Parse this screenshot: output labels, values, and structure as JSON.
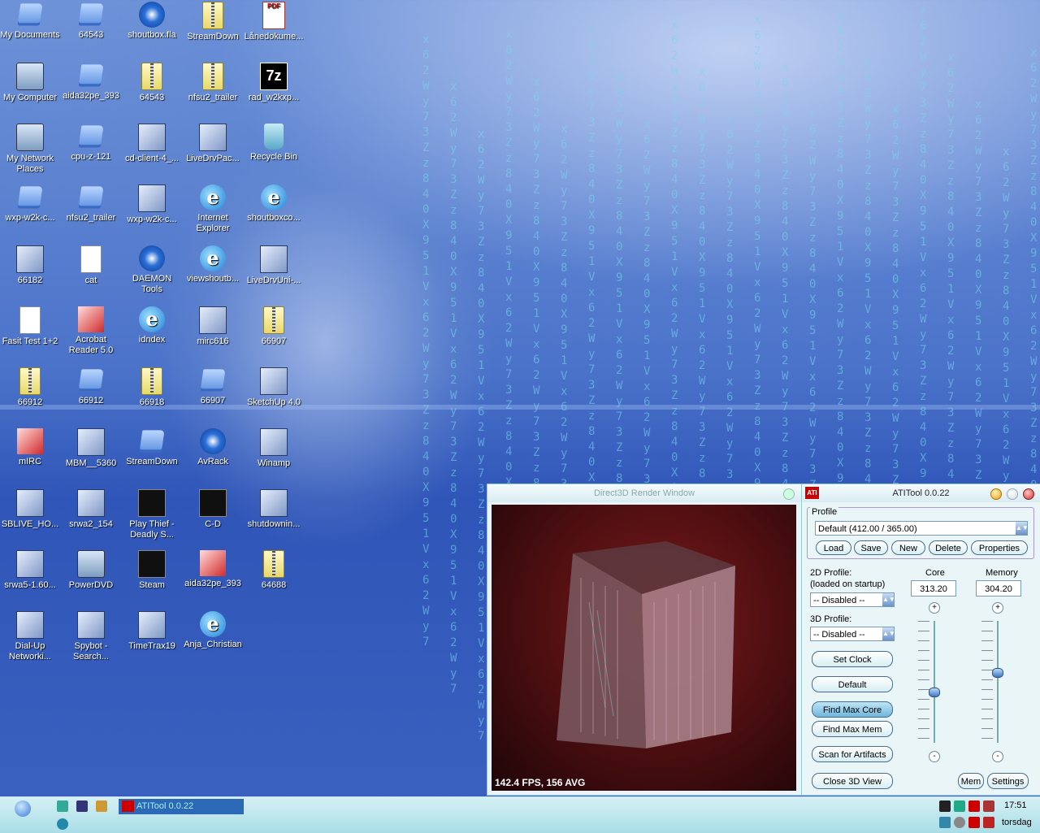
{
  "desktop": {
    "icons": [
      {
        "label": "My Documents",
        "icon": "my-documents-icon"
      },
      {
        "label": "64543",
        "icon": "folder-icon"
      },
      {
        "label": "shoutbox.fla",
        "icon": "flash-file-icon"
      },
      {
        "label": "StreamDown",
        "icon": "zip-folder-icon"
      },
      {
        "label": "Lånedokume...",
        "icon": "pdf-icon"
      },
      {
        "label": "My Computer",
        "icon": "my-computer-icon"
      },
      {
        "label": "aida32pe_393",
        "icon": "folder-icon"
      },
      {
        "label": "64543",
        "icon": "zip-folder-icon"
      },
      {
        "label": "nfsu2_trailer",
        "icon": "zip-folder-icon"
      },
      {
        "label": "rad_w2kxp...",
        "icon": "7z-archive-icon"
      },
      {
        "label": "My Network Places",
        "icon": "network-places-icon"
      },
      {
        "label": "cpu-z-121",
        "icon": "folder-icon"
      },
      {
        "label": "cd-client-4_...",
        "icon": "installer-icon"
      },
      {
        "label": "LiveDrvPac...",
        "icon": "installer-icon"
      },
      {
        "label": "Recycle Bin",
        "icon": "recycle-bin-icon"
      },
      {
        "label": "wxp-w2k-c...",
        "icon": "folder-icon"
      },
      {
        "label": "nfsu2_trailer",
        "icon": "folder-icon"
      },
      {
        "label": "wxp-w2k-c...",
        "icon": "installer-icon"
      },
      {
        "label": "Internet Explorer",
        "icon": "internet-explorer-icon"
      },
      {
        "label": "shoutboxco...",
        "icon": "ie-document-icon"
      },
      {
        "label": "66182",
        "icon": "installer-icon"
      },
      {
        "label": "cat",
        "icon": "text-document-icon"
      },
      {
        "label": "DAEMON Tools",
        "icon": "daemon-tools-icon"
      },
      {
        "label": "viewshoutb...",
        "icon": "ie-document-icon"
      },
      {
        "label": "LiveDrvUni-...",
        "icon": "installer-icon"
      },
      {
        "label": "Fasit Test 1+2",
        "icon": "text-document-icon"
      },
      {
        "label": "Acrobat Reader 5.0",
        "icon": "acrobat-icon"
      },
      {
        "label": "idndex",
        "icon": "ie-document-icon"
      },
      {
        "label": "mirc616",
        "icon": "installer-icon"
      },
      {
        "label": "66907",
        "icon": "zip-folder-icon"
      },
      {
        "label": "66912",
        "icon": "zip-folder-icon"
      },
      {
        "label": "66912",
        "icon": "folder-icon"
      },
      {
        "label": "66918",
        "icon": "zip-folder-icon"
      },
      {
        "label": "66907",
        "icon": "folder-icon"
      },
      {
        "label": "SketchUp 4.0",
        "icon": "sketchup-icon"
      },
      {
        "label": "mIRC",
        "icon": "mirc-icon"
      },
      {
        "label": "MBM__5360",
        "icon": "installer-icon"
      },
      {
        "label": "StreamDown",
        "icon": "folder-icon"
      },
      {
        "label": "AvRack",
        "icon": "avrack-icon"
      },
      {
        "label": "Winamp",
        "icon": "winamp-icon"
      },
      {
        "label": "SBLIVE_HO...",
        "icon": "installer-icon"
      },
      {
        "label": "srwa2_154",
        "icon": "installer-icon"
      },
      {
        "label": "Play Thief - Deadly S...",
        "icon": "game-icon"
      },
      {
        "label": "C-D",
        "icon": "cd-app-icon"
      },
      {
        "label": "shutdownin...",
        "icon": "installer-icon"
      },
      {
        "label": "srwa5-1.60...",
        "icon": "installer-icon"
      },
      {
        "label": "PowerDVD",
        "icon": "powerdvd-icon"
      },
      {
        "label": "Steam",
        "icon": "steam-icon"
      },
      {
        "label": "aida32pe_393",
        "icon": "winrar-icon"
      },
      {
        "label": "64688",
        "icon": "zip-folder-icon"
      },
      {
        "label": "Dial-Up Networki...",
        "icon": "dialup-icon"
      },
      {
        "label": "Spybot - Search...",
        "icon": "spybot-icon"
      },
      {
        "label": "TimeTrax19",
        "icon": "installer-icon"
      },
      {
        "label": "Anja_Christian",
        "icon": "ie-document-icon"
      }
    ]
  },
  "d3d_window": {
    "title": "Direct3D Render Window",
    "fps_text": "142.4 FPS, 156 AVG"
  },
  "atitool": {
    "title": "ATITool 0.0.22",
    "profile_label": "Profile",
    "profile_value": "Default (412.00 / 365.00)",
    "buttons": {
      "load": "Load",
      "save": "Save",
      "new": "New",
      "delete": "Delete",
      "properties": "Properties"
    },
    "profile2d_label": "2D Profile:",
    "profile2d_sub": "(loaded on startup)",
    "profile2d_value": "-- Disabled --",
    "profile3d_label": "3D Profile:",
    "profile3d_value": "-- Disabled --",
    "core_label": "Core",
    "core_value": "313.20",
    "memory_label": "Memory",
    "memory_value": "304.20",
    "core_level": 0.42,
    "memory_level": 0.58,
    "actions": {
      "set_clock": "Set Clock",
      "default": "Default",
      "find_max_core": "Find Max Core",
      "find_max_mem": "Find Max Mem",
      "scan_artifacts": "Scan for Artifacts",
      "close_3d": "Close 3D View",
      "mem": "Mem",
      "settings": "Settings"
    }
  },
  "taskbar": {
    "task_label": "ATITool 0.0.22",
    "clock": "17:51",
    "day": "torsdag"
  }
}
